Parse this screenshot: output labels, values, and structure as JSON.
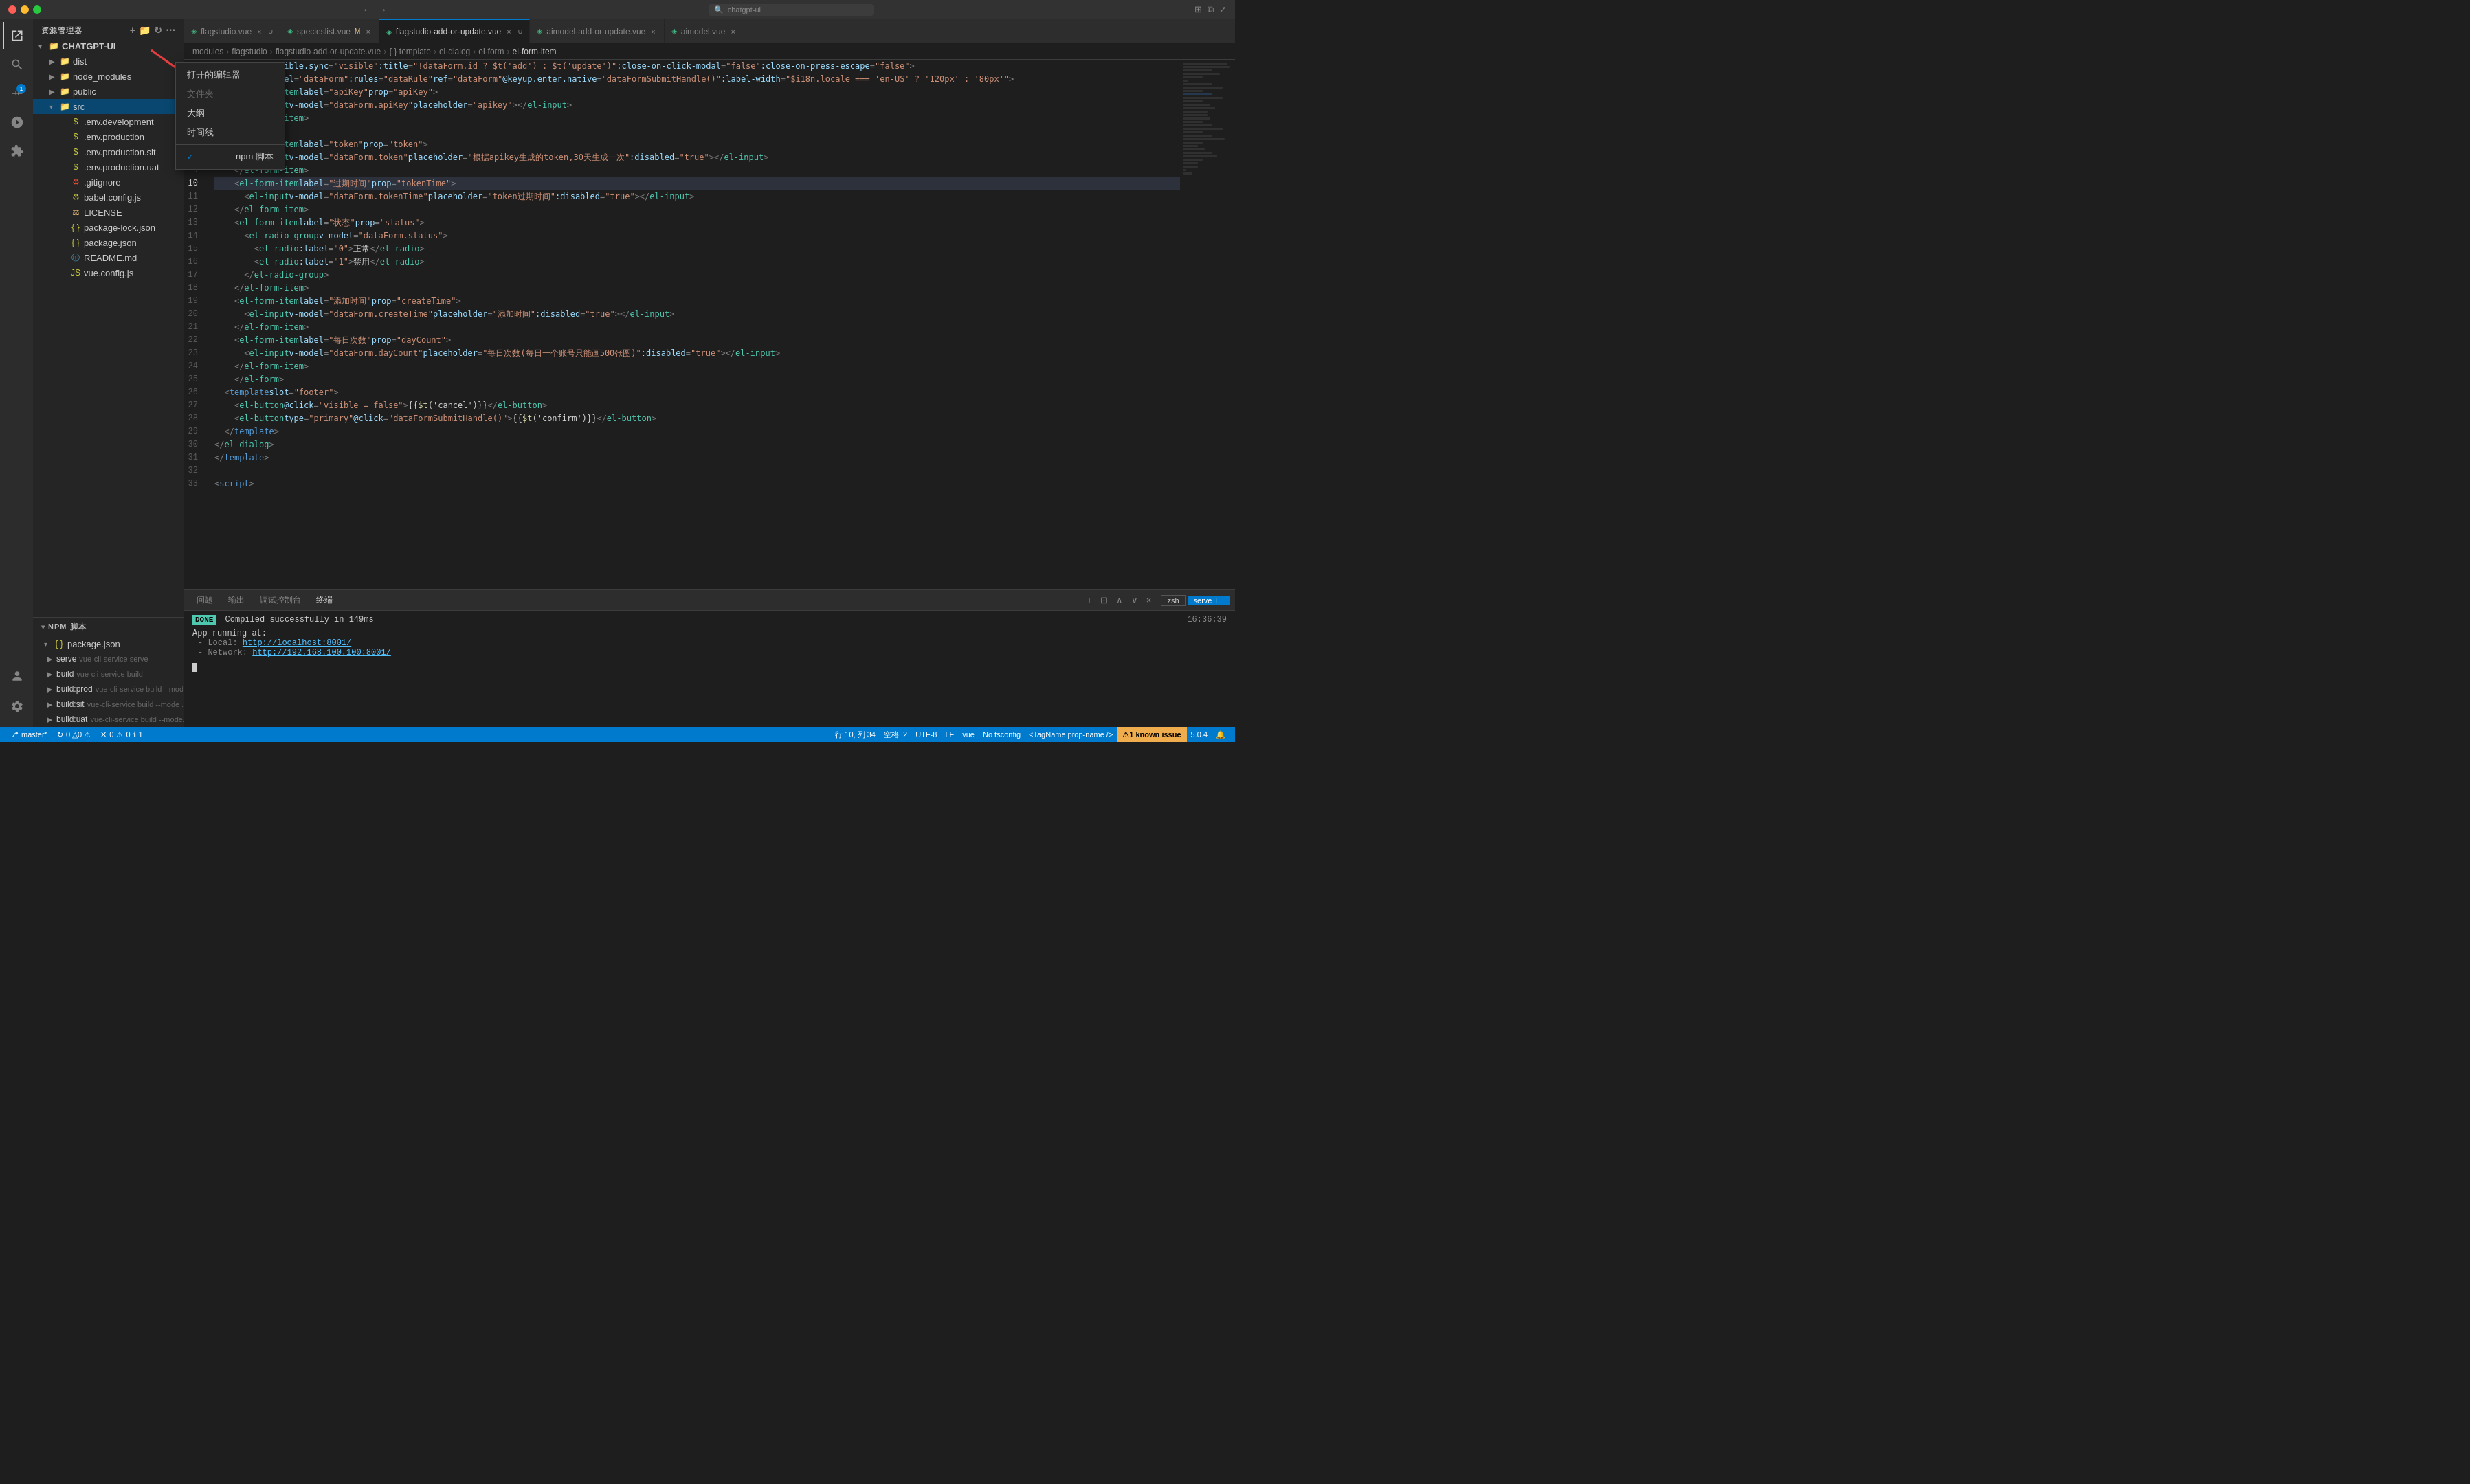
{
  "titlebar": {
    "search_placeholder": "chatgpt-ui",
    "nav_back": "←",
    "nav_forward": "→"
  },
  "tabs": [
    {
      "id": "tab-flagstudio",
      "label": "flagstudio.vue",
      "type": "vue",
      "modified": false,
      "active": false,
      "closable": true
    },
    {
      "id": "tab-specieslist",
      "label": "specieslist.vue",
      "type": "vue",
      "modified": true,
      "active": false,
      "closable": true
    },
    {
      "id": "tab-flagstudio-add",
      "label": "flagstudio-add-or-update.vue",
      "type": "vue",
      "modified": false,
      "active": true,
      "closable": true
    },
    {
      "id": "tab-aimodel-add",
      "label": "aimodel-add-or-update.vue",
      "type": "vue",
      "modified": false,
      "active": false,
      "closable": true
    },
    {
      "id": "tab-aimodel",
      "label": "aimodel.vue",
      "type": "vue",
      "modified": false,
      "active": false,
      "closable": true
    }
  ],
  "breadcrumb": {
    "parts": [
      "modules",
      "flagstudio",
      "flagstudio-add-or-update.vue",
      "{ } template",
      "el-dialog",
      "el-form",
      "el-form-item"
    ]
  },
  "sidebar": {
    "title": "资源管理器",
    "root": "CHATGPT-UI",
    "items": [
      {
        "label": "dist",
        "type": "folder",
        "indent": 1,
        "expanded": false
      },
      {
        "label": "node_modules",
        "type": "folder",
        "indent": 1,
        "expanded": false
      },
      {
        "label": "public",
        "type": "folder",
        "indent": 1,
        "expanded": false
      },
      {
        "label": "src",
        "type": "folder",
        "indent": 1,
        "expanded": true,
        "selected": true
      },
      {
        "label": ".env.development",
        "type": "env",
        "indent": 2
      },
      {
        "label": ".env.production",
        "type": "env",
        "indent": 2
      },
      {
        "label": ".env.production.sit",
        "type": "env",
        "indent": 2
      },
      {
        "label": ".env.production.uat",
        "type": "env",
        "indent": 2
      },
      {
        "label": ".gitignore",
        "type": "git",
        "indent": 2
      },
      {
        "label": "babel.config.js",
        "type": "js",
        "indent": 2
      },
      {
        "label": "LICENSE",
        "type": "license",
        "indent": 2
      },
      {
        "label": "package-lock.json",
        "type": "json",
        "indent": 2
      },
      {
        "label": "package.json",
        "type": "json",
        "indent": 2
      },
      {
        "label": "README.md",
        "type": "readme",
        "indent": 2
      },
      {
        "label": "vue.config.js",
        "type": "js",
        "indent": 2
      }
    ]
  },
  "npm_scripts": {
    "title": "NPM 脚本",
    "package": "package.json",
    "scripts": [
      {
        "name": "serve",
        "cmd": "vue-cli-service serve"
      },
      {
        "name": "build",
        "cmd": "vue-cli-service build"
      },
      {
        "name": "build:prod",
        "cmd": "vue-cli-service build --mod..."
      },
      {
        "name": "build:sit",
        "cmd": "vue-cli-service build --mode ..."
      },
      {
        "name": "build:uat",
        "cmd": "vue-cli-service build --mode..."
      }
    ]
  },
  "context_menu": {
    "items": [
      {
        "label": "打开的编辑器",
        "disabled": false,
        "checked": false
      },
      {
        "label": "文件夹",
        "disabled": true,
        "checked": false
      },
      {
        "label": "大纲",
        "disabled": false,
        "checked": false
      },
      {
        "label": "时间线",
        "disabled": false,
        "checked": false
      },
      {
        "separator": false
      },
      {
        "label": "npm 脚本",
        "disabled": false,
        "checked": true
      }
    ]
  },
  "editor": {
    "filename": "flagstudio-add-or-update.vue",
    "language": "vue",
    "encoding": "UTF-8",
    "line_ending": "LF",
    "cursor": {
      "line": 10,
      "col": 34
    },
    "indent": "空格: 2",
    "lines": [
      {
        "num": 1,
        "content": "<el-dialog :visible.sync=\"visible\" :title=\"!dataForm.id ? $t('add') : $t('update')\" :close-on-click-modal=\"false\" :close-on-press-escape=\"false\">"
      },
      {
        "num": 2,
        "content": "  <el-form :model=\"dataForm\" :rules=\"dataRule\" ref=\"dataForm\" @keyup.enter.native=\"dataFormSubmitHandle()\" :label-width=\"$i18n.locale === 'en-US' ? '120px' : '80px'\">"
      },
      {
        "num": 3,
        "content": "    <el-form-item label=\"apiKey\" prop=\"apiKey\">"
      },
      {
        "num": 4,
        "content": "      <el-input v-model=\"dataForm.apiKey\" placeholder=\"apikey\"></el-input>"
      },
      {
        "num": 5,
        "content": "    </el-form-item>"
      },
      {
        "num": 6,
        "content": ""
      },
      {
        "num": 7,
        "content": "    <el-form-item label=\"token\" prop=\"token\">"
      },
      {
        "num": 8,
        "content": "      <el-input v-model=\"dataForm.token\" placeholder=\"根据apikey生成的token,30天生成一次\" :disabled=\"true\"></el-input>"
      },
      {
        "num": 9,
        "content": "    </el-form-item>"
      },
      {
        "num": 10,
        "content": "    <el-form-item label=\"过期时间\" prop=\"tokenTime\">"
      },
      {
        "num": 11,
        "content": "      <el-input v-model=\"dataForm.tokenTime\" placeholder=\"token过期时间\" :disabled=\"true\"></el-input>"
      },
      {
        "num": 12,
        "content": "    </el-form-item>"
      },
      {
        "num": 13,
        "content": "    <el-form-item label=\"状态\" prop=\"status\">"
      },
      {
        "num": 14,
        "content": "      <el-radio-group v-model=\"dataForm.status\">"
      },
      {
        "num": 15,
        "content": "        <el-radio :label=\"0\">正常</el-radio>"
      },
      {
        "num": 16,
        "content": "        <el-radio :label=\"1\">禁用</el-radio>"
      },
      {
        "num": 17,
        "content": "      </el-radio-group>"
      },
      {
        "num": 18,
        "content": "    </el-form-item>"
      },
      {
        "num": 19,
        "content": "    <el-form-item label=\"添加时间\" prop=\"createTime\">"
      },
      {
        "num": 20,
        "content": "      <el-input v-model=\"dataForm.createTime\" placeholder=\"添加时间\" :disabled=\"true\"></el-input>"
      },
      {
        "num": 21,
        "content": "    </el-form-item>"
      },
      {
        "num": 22,
        "content": "    <el-form-item label=\"每日次数\" prop=\"dayCount\">"
      },
      {
        "num": 23,
        "content": "      <el-input v-model=\"dataForm.dayCount\" placeholder=\"每日次数(每日一个账号只能画500张图)\" :disabled=\"true\"></el-input>"
      },
      {
        "num": 24,
        "content": "    </el-form-item>"
      },
      {
        "num": 25,
        "content": "    </el-form>"
      },
      {
        "num": 26,
        "content": "  <template slot=\"footer\">"
      },
      {
        "num": 27,
        "content": "    <el-button @click=\"visible = false\">{{ $t('cancel') }}</el-button>"
      },
      {
        "num": 28,
        "content": "    <el-button type=\"primary\" @click=\"dataFormSubmitHandle()\">{{ $t('confirm') }}</el-button>"
      },
      {
        "num": 29,
        "content": "  </template>"
      },
      {
        "num": 30,
        "content": "</el-dialog>"
      },
      {
        "num": 31,
        "content": "</template>"
      },
      {
        "num": 32,
        "content": ""
      },
      {
        "num": 33,
        "content": "<script>"
      }
    ]
  },
  "terminal": {
    "tabs": [
      "问题",
      "输出",
      "调试控制台",
      "终端"
    ],
    "active_tab": "终端",
    "done_text": "DONE",
    "compile_msg": "Compiled successfully in 149ms",
    "timestamp": "16:36:39",
    "app_running": "App running at:",
    "local_url": "http://localhost:8001/",
    "network_url": "http://192.168.100.100:8001/",
    "terminal_name": "zsh",
    "serve_label": "serve T..."
  },
  "statusbar": {
    "branch": "master*",
    "sync_icon": "↻",
    "errors": "0",
    "warnings": "0 △",
    "info": "1",
    "cursor_pos": "行 10, 列 34",
    "indent": "空格: 2",
    "encoding": "UTF-8",
    "line_ending": "LF",
    "language": "vue",
    "tsconfig": "No tsconfig",
    "tag_name": "<TagName prop-name />",
    "known_issue": "1 known issue",
    "version": "5.0.4"
  },
  "colors": {
    "accent": "#007acc",
    "background": "#1e1e1e",
    "sidebar_bg": "#252526",
    "tab_active_bg": "#1e1e1e",
    "tab_inactive_bg": "#2d2d2d",
    "terminal_bg": "#1e1e1e",
    "statusbar_bg": "#007acc"
  }
}
